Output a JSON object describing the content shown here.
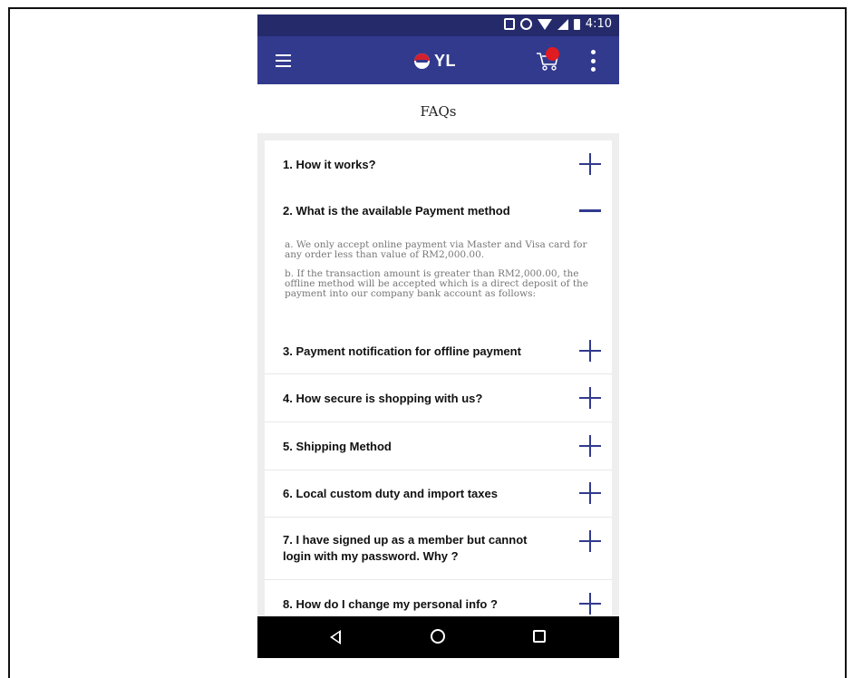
{
  "status_bar": {
    "time": "4:10"
  },
  "app_bar": {
    "logo_text": "YL",
    "cart_badge": "+9"
  },
  "page": {
    "title": "FAQs"
  },
  "faqs": [
    {
      "question": "1. How it works?",
      "expanded": false
    },
    {
      "question": "2. What is the available Payment method",
      "expanded": true,
      "answer_a": "a. We only accept online payment via Master and Visa card for any order less than value of RM2,000.00.",
      "answer_b": "b. If the transaction amount is greater than RM2,000.00, the offline method will be accepted which is a direct deposit of the payment into our company bank account as follows:"
    },
    {
      "question": "3. Payment notification for offline payment",
      "expanded": false
    },
    {
      "question": "4. How secure is shopping with us?",
      "expanded": false
    },
    {
      "question": "5. Shipping Method",
      "expanded": false
    },
    {
      "question": "6. Local custom duty and import taxes",
      "expanded": false
    },
    {
      "question": "7. I have signed up as a member but cannot login with my password. Why ?",
      "expanded": false
    },
    {
      "question": "8. How do I change my personal info ?",
      "expanded": false
    }
  ],
  "icons": {
    "menu": "menu-icon",
    "cart": "cart-icon",
    "more": "more-vert-icon",
    "expand": "plus-icon",
    "collapse": "minus-icon",
    "nav_back": "back-triangle-icon",
    "nav_home": "home-circle-icon",
    "nav_recent": "recents-square-icon"
  },
  "colors": {
    "status_bar": "#252a6b",
    "app_bar": "#323a8e",
    "accent": "#323a8e",
    "badge": "#e11b22",
    "nav_bar": "#000000"
  }
}
